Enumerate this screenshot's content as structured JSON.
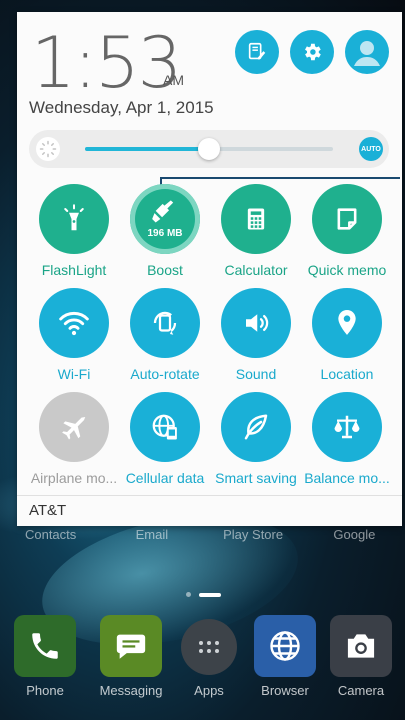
{
  "header": {
    "time": "1:53",
    "ampm": "AM",
    "date": "Wednesday, Apr 1, 2015"
  },
  "header_buttons": [
    {
      "name": "edit-button",
      "icon": "edit-icon"
    },
    {
      "name": "settings-button",
      "icon": "gear-icon"
    },
    {
      "name": "user-avatar-button",
      "icon": "avatar-icon"
    }
  ],
  "brightness": {
    "level_fraction": 0.5,
    "auto_label": "AUTO"
  },
  "tiles": [
    {
      "label": "FlashLight",
      "icon": "flashlight-icon",
      "color": "#1fb08e",
      "label_style": "green"
    },
    {
      "label": "Boost",
      "icon": "boost-broom-icon",
      "color": "#1fb08e",
      "label_style": "green",
      "badge": "196 MB"
    },
    {
      "label": "Calculator",
      "icon": "calculator-icon",
      "color": "#1fb08e",
      "label_style": "green"
    },
    {
      "label": "Quick memo",
      "icon": "memo-icon",
      "color": "#1fb08e",
      "label_style": "green"
    },
    {
      "label": "Wi-Fi",
      "icon": "wifi-icon",
      "color": "#1ab0d7",
      "label_style": "blue"
    },
    {
      "label": "Auto-rotate",
      "icon": "auto-rotate-icon",
      "color": "#1ab0d7",
      "label_style": "blue"
    },
    {
      "label": "Sound",
      "icon": "sound-icon",
      "color": "#1ab0d7",
      "label_style": "blue"
    },
    {
      "label": "Location",
      "icon": "location-icon",
      "color": "#1ab0d7",
      "label_style": "blue"
    },
    {
      "label": "Airplane mo...",
      "icon": "airplane-icon",
      "color": "#c9c9c9",
      "label_style": "grey"
    },
    {
      "label": "Cellular data",
      "icon": "cellular-data-icon",
      "color": "#1ab0d7",
      "label_style": "blue"
    },
    {
      "label": "Smart saving",
      "icon": "leaf-icon",
      "color": "#1ab0d7",
      "label_style": "blue"
    },
    {
      "label": "Balance mo...",
      "icon": "balance-icon",
      "color": "#1ab0d7",
      "label_style": "blue"
    }
  ],
  "carrier": "AT&T",
  "home": {
    "shortcut_labels": [
      "Contacts",
      "Email",
      "Play Store",
      "Google"
    ],
    "dock": [
      {
        "label": "Phone",
        "icon": "phone-icon",
        "color": "#2e7d32"
      },
      {
        "label": "Messaging",
        "icon": "message-icon",
        "color": "#6a9a2c"
      },
      {
        "label": "Apps",
        "icon": "apps-icon",
        "color": "#3a3f45"
      },
      {
        "label": "Browser",
        "icon": "globe-icon",
        "color": "#2867b3"
      },
      {
        "label": "Camera",
        "icon": "camera-icon",
        "color": "#3c4048"
      }
    ]
  }
}
